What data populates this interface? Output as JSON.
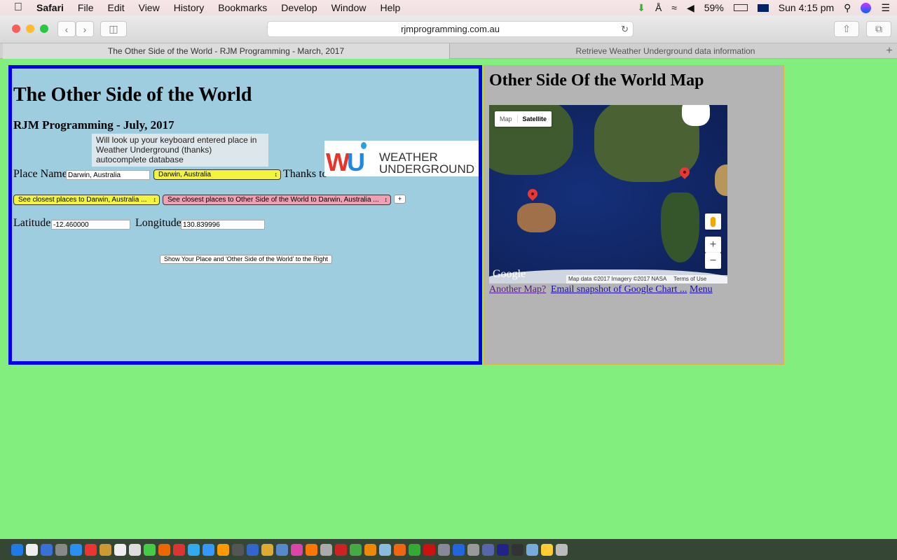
{
  "menubar": {
    "apple": "",
    "app": "Safari",
    "items": [
      "File",
      "Edit",
      "View",
      "History",
      "Bookmarks",
      "Develop",
      "Window",
      "Help"
    ],
    "battery": "59%",
    "clock": "Sun 4:15 pm"
  },
  "browser": {
    "url": "rjmprogramming.com.au",
    "tabs": [
      {
        "label": "The Other Side of the World - RJM Programming - March, 2017",
        "active": true
      },
      {
        "label": "Retrieve Weather Underground data information",
        "active": false
      }
    ],
    "new_tab": "+"
  },
  "left": {
    "title": "The Other Side of the World",
    "subtitle": "RJM Programming - July, 2017",
    "tooltip": "Will look up your keyboard entered place in Weather Underground (thanks) autocomplete database",
    "place_label": "Place Name:",
    "place_value": "Darwin, Australia",
    "place_select": "Darwin, Australia",
    "thanks": "Thanks to",
    "logo_text": [
      "WEATHER",
      "UNDERGROUND"
    ],
    "closest_select": "See closest places to Darwin, Australia ...",
    "other_select": "See closest places to Other Side of the World to Darwin, Australia ...",
    "plus": "+",
    "lat_label": "Latitude:",
    "lat_value": "-12.460000",
    "lon_label": "Longitude:",
    "lon_value": "130.839996",
    "show_button": "Show Your Place and 'Other Side of the World' to the Right"
  },
  "right": {
    "title": "Other Side Of the World Map",
    "map": {
      "type_map": "Map",
      "type_satellite": "Satellite",
      "selected": "Satellite",
      "google": "Google",
      "attribution": "Map data ©2017 Imagery ©2017 NASA",
      "terms": "Terms of Use",
      "zoom_in": "+",
      "zoom_out": "−"
    },
    "links": [
      "Another Map?",
      "Email snapshot of Google Chart ...",
      "Menu"
    ]
  },
  "colors": {
    "page_bg": "#82ee7e",
    "left_bg": "#9ecde0",
    "left_border": "#0000ee",
    "right_bg": "#b4b4b4",
    "select_yellow": "#f4f43c",
    "select_pink": "#f0a0b4"
  }
}
